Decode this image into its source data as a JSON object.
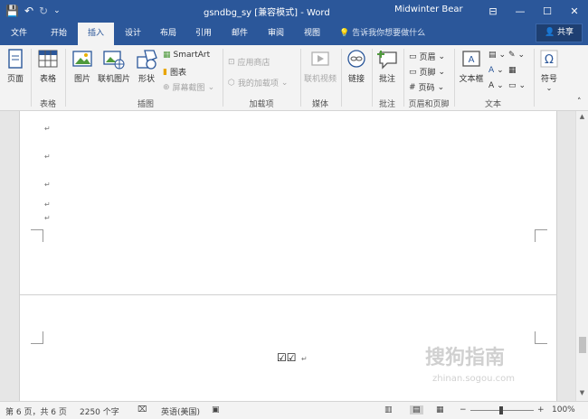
{
  "window": {
    "title": "gsndbg_sy [兼容模式] - Word",
    "user": "Midwinter Bear",
    "share_label": "共享",
    "tell_me": "告诉我你想要做什么"
  },
  "tabs": [
    "文件",
    "开始",
    "插入",
    "设计",
    "布局",
    "引用",
    "邮件",
    "审阅",
    "视图"
  ],
  "active_tab": "插入",
  "ribbon": {
    "pages": {
      "label": "页面",
      "group": ""
    },
    "table": {
      "label": "表格",
      "group": "表格"
    },
    "illustrations": {
      "picture": "图片",
      "online_picture": "联机图片",
      "shapes": "形状",
      "smartart": "SmartArt",
      "chart": "图表",
      "screenshot": "屏幕截图",
      "group": "插图"
    },
    "addins": {
      "store": "应用商店",
      "my_addins": "我的加载项",
      "group": "加载项"
    },
    "media": {
      "online_video": "联机视频",
      "group": "媒体"
    },
    "links": {
      "label": "链接"
    },
    "comments": {
      "comment": "批注",
      "group": "批注"
    },
    "header_footer": {
      "header": "页眉",
      "footer": "页脚",
      "page_number": "页码",
      "group": "页眉和页脚"
    },
    "text": {
      "textbox": "文本框",
      "group": "文本"
    },
    "symbols": {
      "symbol": "符号"
    }
  },
  "document": {
    "paragraph_mark": "↵",
    "checkboxes": "☑☑"
  },
  "status": {
    "page": "第 6 页，共 6 页",
    "words": "2250 个字",
    "language": "英语(美国)",
    "zoom": "100%"
  },
  "watermark": {
    "main": "搜狗指南",
    "sub": "zhinan.sogou.com"
  },
  "colors": {
    "accent": "#2b579a"
  }
}
